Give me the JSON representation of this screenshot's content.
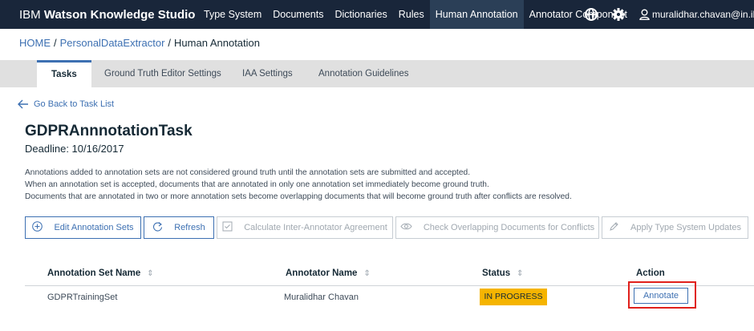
{
  "header": {
    "brand_prefix": "IBM",
    "brand_name": "Watson Knowledge Studio",
    "nav": [
      "Type System",
      "Documents",
      "Dictionaries",
      "Rules",
      "Human Annotation",
      "Annotator Component"
    ],
    "active_nav": "Human Annotation",
    "user": "muralidhar.chavan@in.ibm.co"
  },
  "breadcrumb": {
    "home": "HOME",
    "project": "PersonalDataExtractor",
    "current": "Human Annotation",
    "separator": "/"
  },
  "tabs": [
    "Tasks",
    "Ground Truth Editor Settings",
    "IAA Settings",
    "Annotation Guidelines"
  ],
  "active_tab": "Tasks",
  "back_link": "Go Back to Task List",
  "task": {
    "name": "GDPRAnnnotationTask",
    "deadline": "Deadline: 10/16/2017"
  },
  "info_lines": [
    "Annotations added to annotation sets are not considered ground truth until the annotation sets are submitted and accepted.",
    "When an annotation set is accepted, documents that are annotated in only one annotation set immediately become ground truth.",
    "Documents that are annotated in two or more annotation sets become overlapping documents that will become ground truth after conflicts are resolved."
  ],
  "toolbar": {
    "edit_sets": "Edit Annotation Sets",
    "refresh": "Refresh",
    "calc_iaa": "Calculate Inter-Annotator Agreement",
    "check_overlap": "Check Overlapping Documents for Conflicts",
    "apply_type_system": "Apply Type System Updates"
  },
  "table": {
    "columns": [
      "Annotation Set Name",
      "Annotator Name",
      "Status",
      "Action"
    ],
    "rows": [
      {
        "set_name": "GDPRTrainingSet",
        "annotator": "Muralidhar Chavan",
        "status": "IN PROGRESS",
        "action": "Annotate"
      }
    ]
  },
  "colors": {
    "header_bg": "#19263a",
    "accent": "#3d70b2",
    "status_in_progress": "#f5b400",
    "highlight_box": "#e0201b"
  }
}
